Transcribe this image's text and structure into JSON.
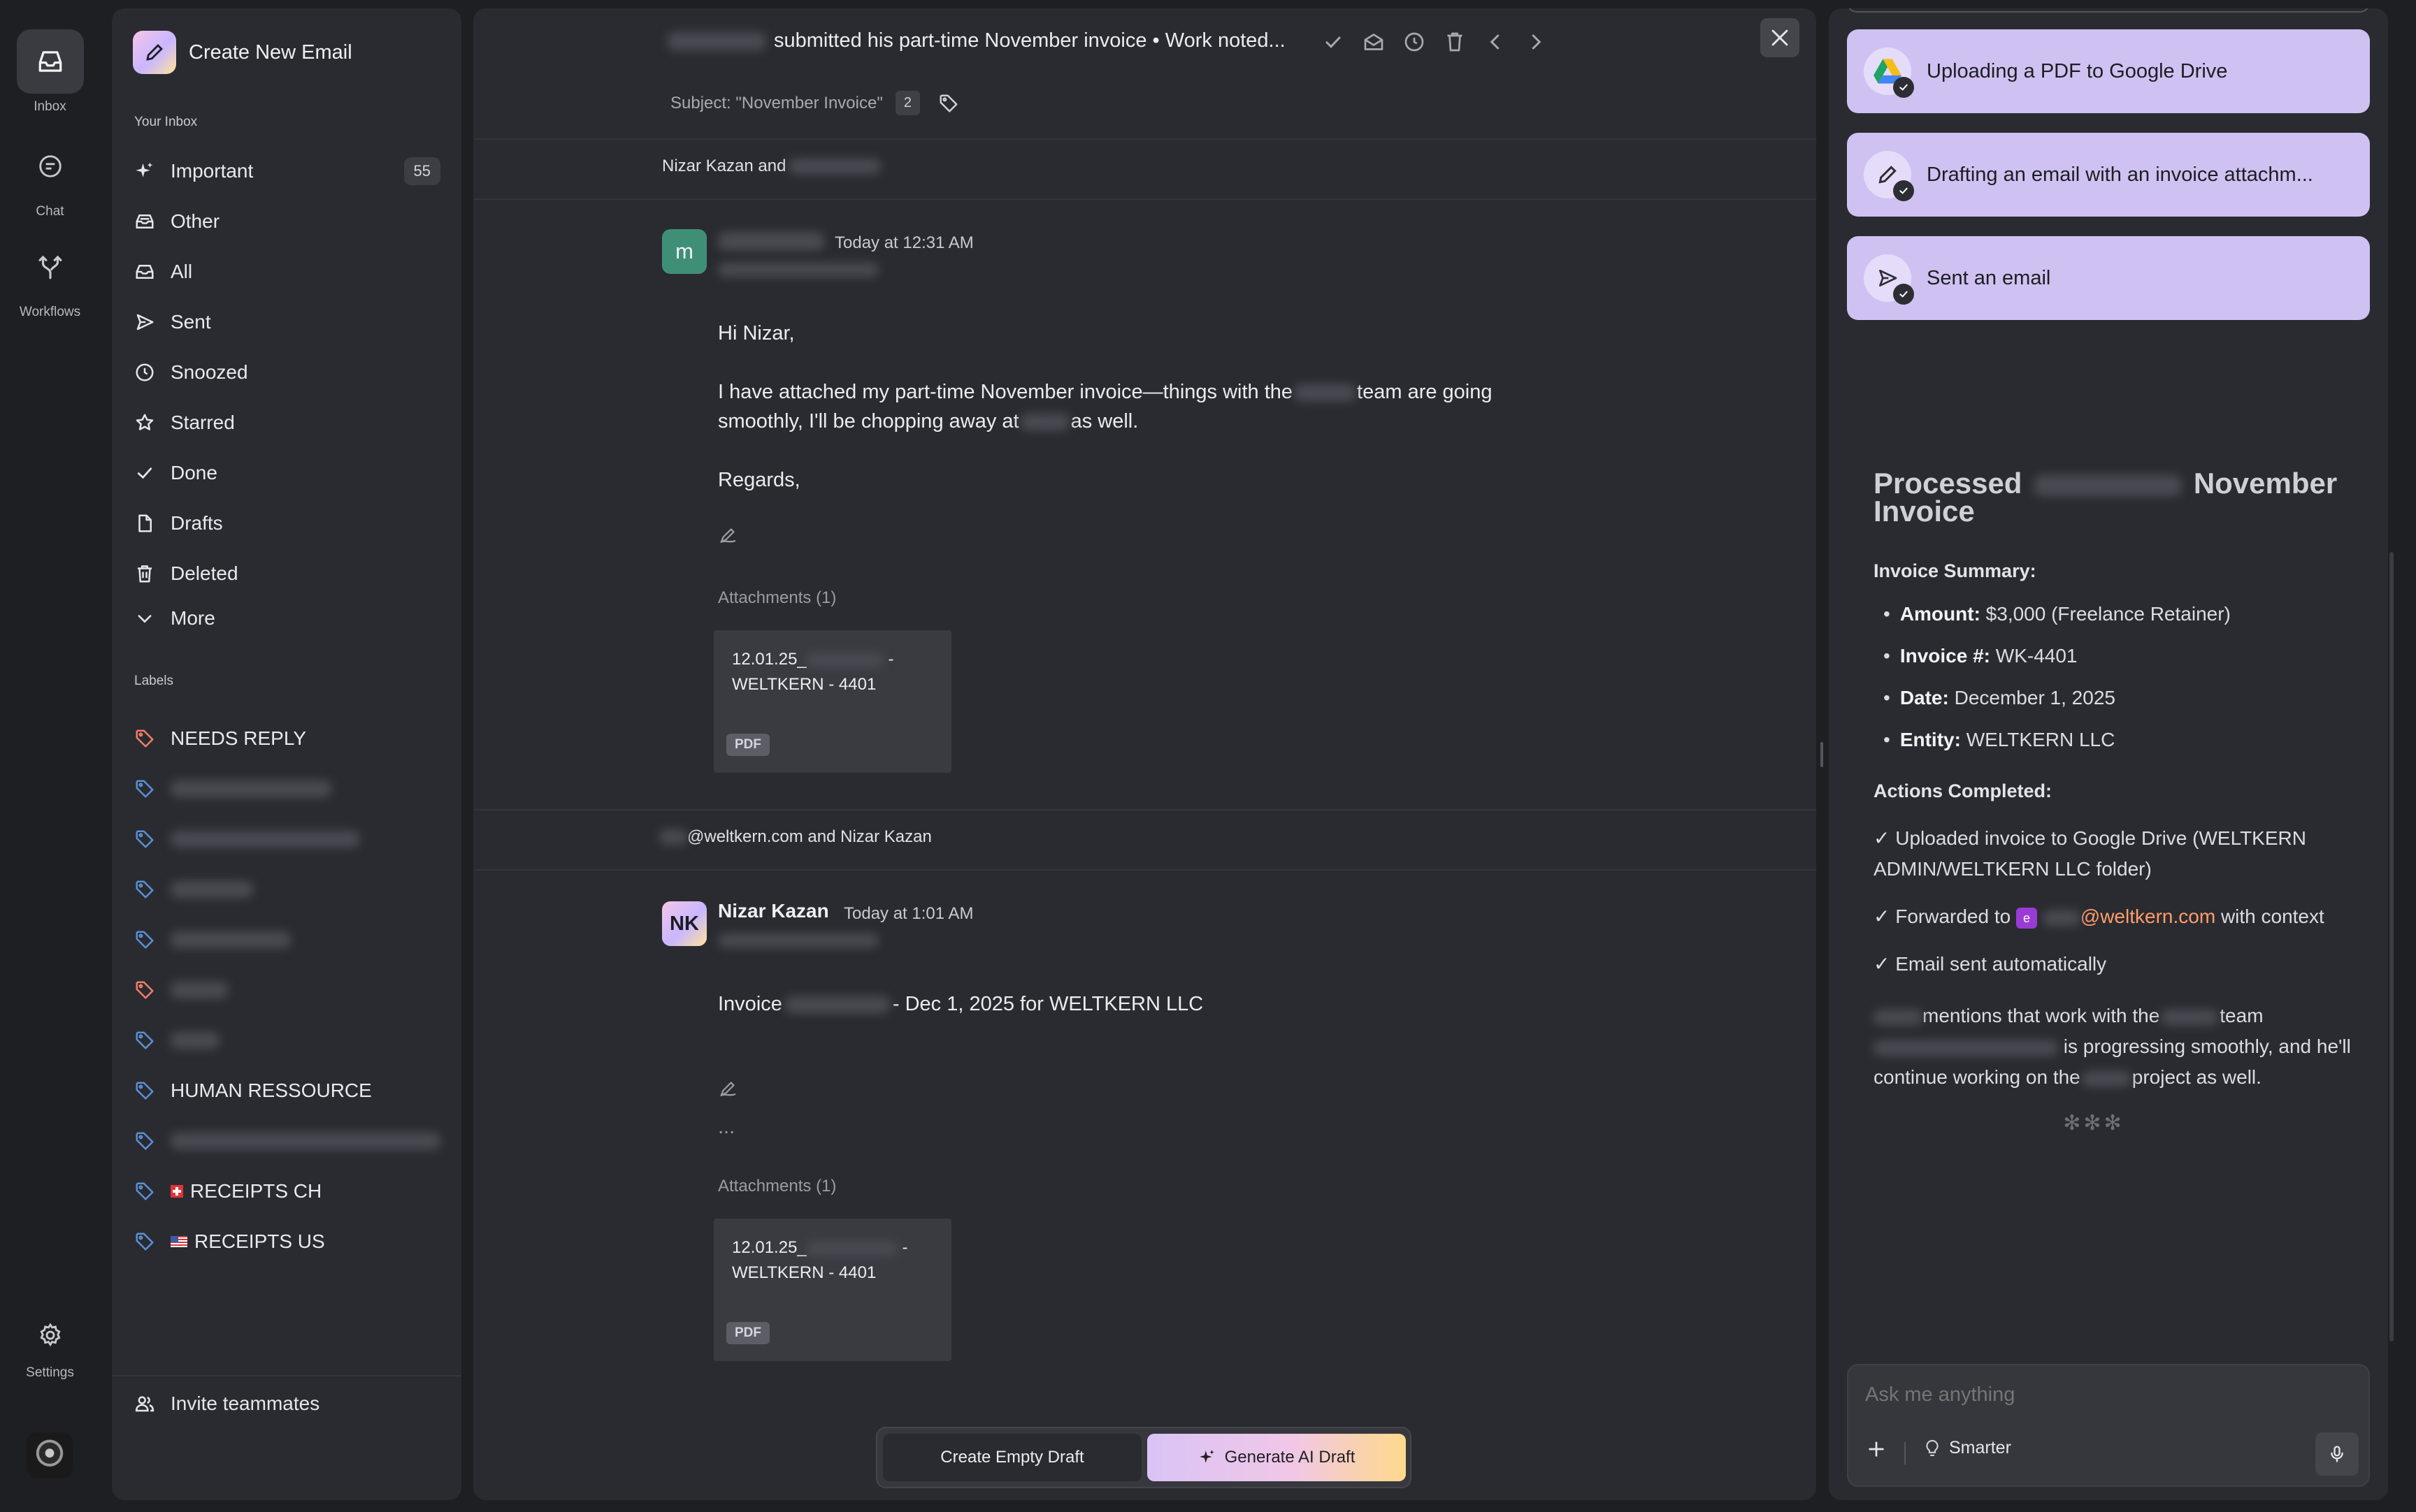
{
  "rail": {
    "items": [
      {
        "label": "Inbox",
        "icon": "inbox-icon"
      },
      {
        "label": "Chat",
        "icon": "chat-icon"
      },
      {
        "label": "Workflows",
        "icon": "workflows-icon"
      }
    ],
    "settings_label": "Settings"
  },
  "nav": {
    "create_label": "Create New Email",
    "inbox_heading": "Your Inbox",
    "inbox_items": [
      {
        "label": "Important",
        "badge": "55",
        "icon": "sparkle-icon"
      },
      {
        "label": "Other",
        "icon": "tray-icon"
      },
      {
        "label": "All",
        "icon": "inbox-icon"
      },
      {
        "label": "Sent",
        "icon": "send-icon"
      },
      {
        "label": "Snoozed",
        "icon": "clock-icon"
      },
      {
        "label": "Starred",
        "icon": "star-icon"
      },
      {
        "label": "Done",
        "icon": "check-icon"
      },
      {
        "label": "Drafts",
        "icon": "file-icon"
      },
      {
        "label": "Deleted",
        "icon": "trash-icon"
      },
      {
        "label": "More",
        "icon": "chevron-down-icon"
      }
    ],
    "labels_heading": "Labels",
    "labels": [
      {
        "label": "NEEDS REPLY",
        "color": "#f07d6b"
      },
      {
        "label": "HUMAN RESSOURCE",
        "color": "#5b8fd6"
      },
      {
        "label": "RECEIPTS CH",
        "color": "#5b8fd6",
        "flag": "ch"
      },
      {
        "label": "RECEIPTS US",
        "color": "#5b8fd6",
        "flag": "us"
      }
    ],
    "invite_label": "Invite teammates"
  },
  "thread": {
    "title": "submitted his part-time November invoice • Work noted...",
    "subject": "Subject: \"November Invoice\"",
    "message_count": "2",
    "participants_1": "Nizar Kazan and",
    "participants_2": "@weltkern.com and Nizar Kazan",
    "messages": [
      {
        "avatar": "m",
        "time": "Today at 12:31 AM",
        "greeting": "Hi Nizar,",
        "line1a": "I have attached my part-time November invoice—things with the",
        "line1b": "team are going",
        "line2a": "smoothly, I'll be chopping away at",
        "line2b": "as well.",
        "signoff": "Regards,",
        "attachments_label": "Attachments (1)",
        "attachment": {
          "name_a": "12.01.25_",
          "name_b": "-",
          "name_c": "WELTKERN - 4401",
          "type": "PDF"
        }
      },
      {
        "avatar": "NK",
        "sender": "Nizar Kazan",
        "time": "Today at 1:01 AM",
        "text_a": "Invoice",
        "text_b": "- Dec 1, 2025 for WELTKERN LLC",
        "ellipsis": "...",
        "attachments_label": "Attachments (1)",
        "attachment": {
          "name_a": "12.01.25_",
          "name_b": "-",
          "name_c": "WELTKERN - 4401",
          "type": "PDF"
        }
      }
    ],
    "draft_empty": "Create Empty Draft",
    "draft_ai": "Generate AI Draft"
  },
  "assistant": {
    "steps": [
      {
        "label": "Uploading a PDF to Google Drive",
        "icon": "google-drive-icon"
      },
      {
        "label": "Drafting an email with an invoice attachm...",
        "icon": "pencil-icon"
      },
      {
        "label": "Sent an email",
        "icon": "send-icon"
      }
    ],
    "summary_title_a": "Processed",
    "summary_title_b": "November Invoice",
    "invoice_summary_h": "Invoice Summary:",
    "summary": [
      {
        "k": "Amount:",
        "v": "$3,000 (Freelance Retainer)"
      },
      {
        "k": "Invoice #:",
        "v": "WK-4401"
      },
      {
        "k": "Date:",
        "v": "December 1, 2025"
      },
      {
        "k": "Entity:",
        "v": "WELTKERN LLC"
      }
    ],
    "actions_h": "Actions Completed:",
    "action1": "✓ Uploaded invoice to Google Drive (WELTKERN ADMIN/WELTKERN LLC folder)",
    "action2a": "✓ Forwarded to",
    "action2_chip": "e",
    "action2_email": "@weltkern.com",
    "action2b": "with context",
    "action3": "✓ Email sent automatically",
    "note_a": "mentions that work with the",
    "note_b": "team",
    "note_c": "is progressing smoothly, and he'll continue working on the",
    "note_d": "project as well.",
    "loader": "✻✻✻",
    "ask_placeholder": "Ask me anything",
    "mode": "Smarter"
  },
  "colors": {
    "accent": "#cfc2f2",
    "orange_link": "#ff9d6b",
    "tag_red": "#f07d6b",
    "tag_blue": "#5b8fd6"
  }
}
